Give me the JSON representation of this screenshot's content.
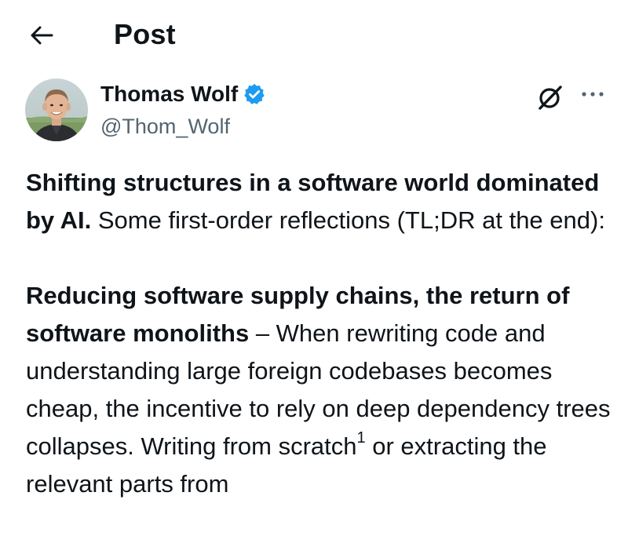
{
  "header": {
    "title": "Post"
  },
  "author": {
    "name": "Thomas Wolf",
    "handle": "@Thom_Wolf",
    "verified": true,
    "verified_color": "#1d9bf0"
  },
  "icons": {
    "back": "arrow-left-icon",
    "verified": "verified-badge-icon",
    "grok": "grok-icon",
    "more": "more-options-icon"
  },
  "post": {
    "para1_bold": "Shifting structures in a software world dominated by AI.",
    "para1_text": " Some first-order reflections (TL;DR at the end):",
    "para2_bold": "Reducing software supply chains, the return of software monoliths",
    "para2_text": " – When rewriting code and understanding large foreign codebases becomes cheap, the incentive to rely on deep dependency trees collapses. Writing from scratch",
    "footnote_marker": "1",
    "para2_text_tail": " or extracting the relevant parts from"
  },
  "colors": {
    "text": "#0f1419",
    "secondary_text": "#536471",
    "background": "#ffffff"
  }
}
